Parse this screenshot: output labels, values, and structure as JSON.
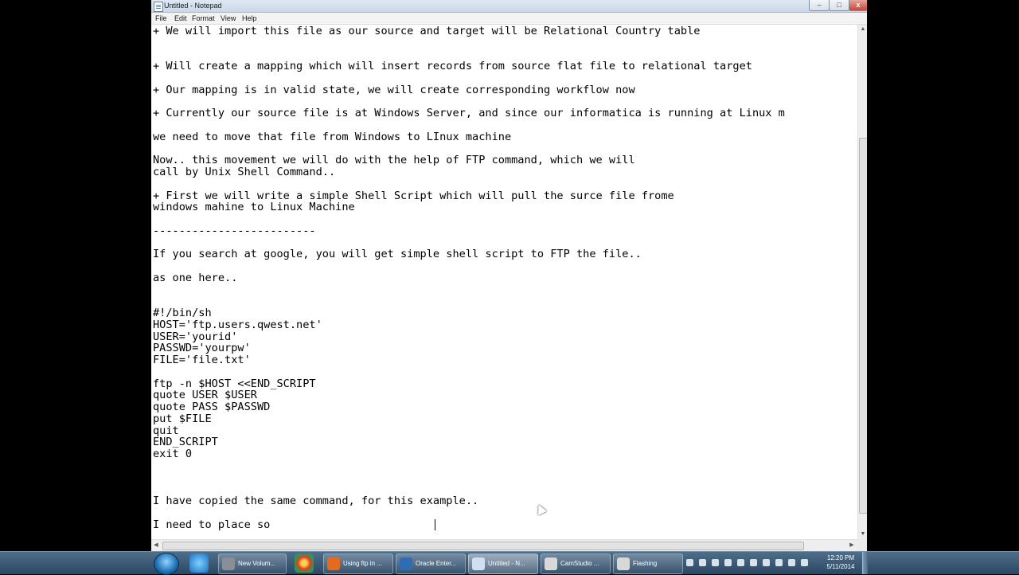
{
  "window": {
    "title": "Untitled - Notepad",
    "controls": {
      "minimize": "–",
      "maximize": "□",
      "close": "x"
    }
  },
  "menu": [
    "File",
    "Edit",
    "Format",
    "View",
    "Help"
  ],
  "editor_lines": [
    "+ We will import this file as our source and target will be Relational Country table",
    "",
    "",
    "+ Will create a mapping which will insert records from source flat file to relational target",
    "",
    "+ Our mapping is in valid state, we will create corresponding workflow now",
    "",
    "+ Currently our source file is at Windows Server, and since our informatica is running at Linux m",
    "",
    "we need to move that file from Windows to LInux machine",
    "",
    "Now.. this movement we will do with the help of FTP command, which we will",
    "call by Unix Shell Command..",
    "",
    "+ First we will write a simple Shell Script which will pull the surce file frome",
    "windows mahine to Linux Machine",
    "",
    "-------------------------",
    "",
    "If you search at google, you will get simple shell script to FTP the file..",
    "",
    "as one here..",
    "",
    "",
    "#!/bin/sh",
    "HOST='ftp.users.qwest.net'",
    "USER='yourid'",
    "PASSWD='yourpw'",
    "FILE='file.txt'",
    "",
    "ftp -n $HOST <<END_SCRIPT",
    "quote USER $USER",
    "quote PASS $PASSWD",
    "put $FILE",
    "quit",
    "END_SCRIPT",
    "exit 0",
    "",
    "",
    "",
    "I have copied the same command, for this example..",
    "",
    "I need to place so"
  ],
  "scrollbar": {
    "up": "▲",
    "down": "▼",
    "left": "◀",
    "right": "▶"
  },
  "taskbar": {
    "buttons": [
      {
        "label": "New Volum...",
        "color": "#8a8f96"
      },
      {
        "label": "Using ftp in ...",
        "color": "#e66a1e"
      },
      {
        "label": "Oracle Enter...",
        "color": "#2f6db3"
      },
      {
        "label": "Untitled - N...",
        "color": "#cfe0f2"
      },
      {
        "label": "CamStudio ...",
        "color": "#d8d8d8"
      },
      {
        "label": "Flashing",
        "color": "#d8d8d8"
      }
    ],
    "clock_time": "12:20 PM",
    "clock_date": "5/11/2014"
  }
}
